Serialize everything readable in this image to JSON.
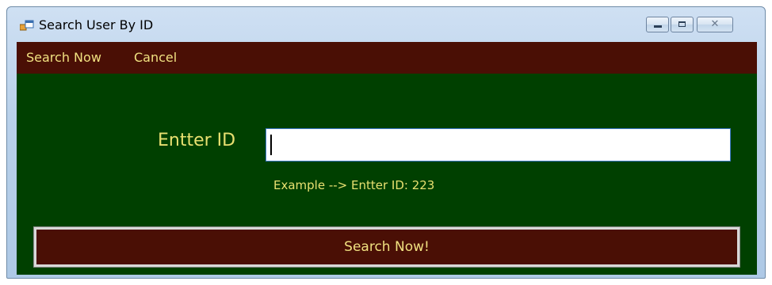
{
  "window": {
    "title": "Search User By ID",
    "controls": {
      "minimize_icon": "minimize-icon",
      "maximize_icon": "maximize-icon",
      "close_icon": "close-icon",
      "close_glyph": "✕"
    }
  },
  "menu": {
    "items": [
      {
        "label": "Search Now"
      },
      {
        "label": "Cancel"
      }
    ]
  },
  "form": {
    "id_label": "Entter ID",
    "id_value": "",
    "hint": "Example --> Entter ID:  223",
    "search_button_label": "Search Now!"
  },
  "colors": {
    "menu_background": "#4a0f05",
    "client_background": "#004000",
    "text_yellow": "#e8e070"
  }
}
